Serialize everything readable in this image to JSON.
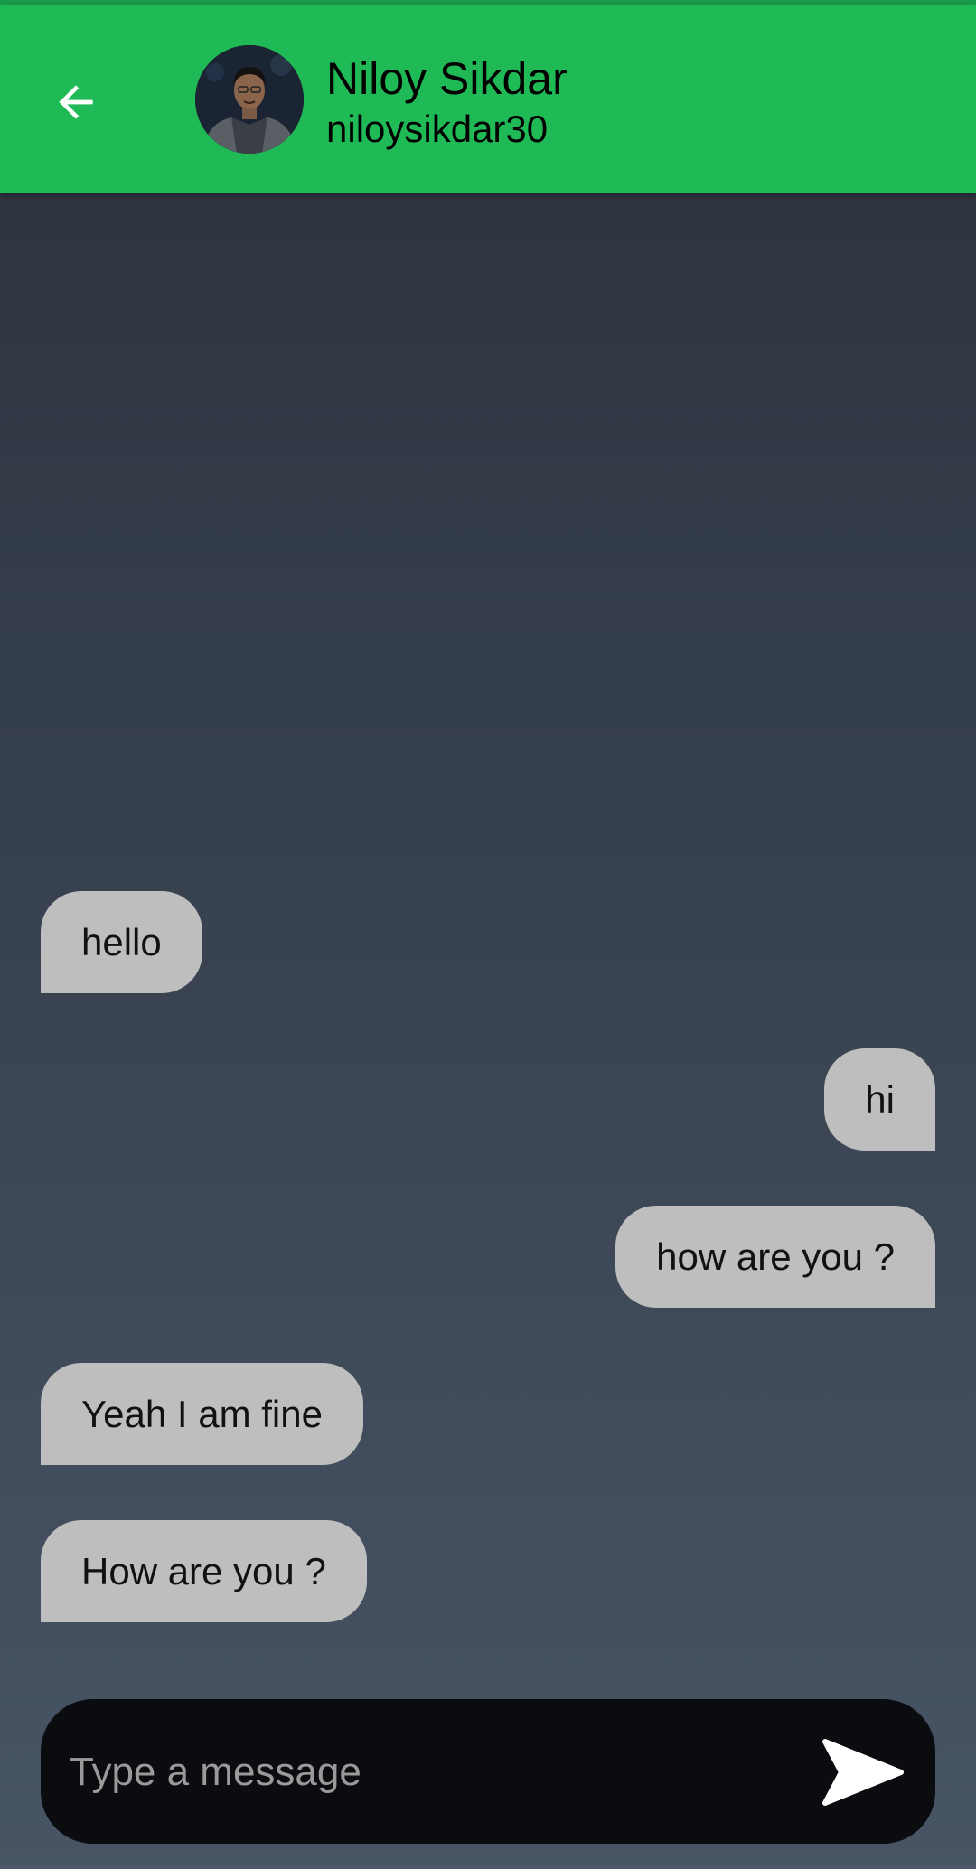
{
  "header": {
    "name": "Niloy Sikdar",
    "username": "niloysikdar30",
    "back_icon": "arrow-left-icon",
    "avatar_icon": "profile-photo"
  },
  "messages": [
    {
      "text": "hello",
      "direction": "received"
    },
    {
      "text": "hi",
      "direction": "sent"
    },
    {
      "text": "how are you ?",
      "direction": "sent"
    },
    {
      "text": "Yeah I am fine",
      "direction": "received"
    },
    {
      "text": "How are you ?",
      "direction": "received"
    }
  ],
  "composer": {
    "placeholder": "Type a message",
    "value": "",
    "send_icon": "send-icon"
  },
  "colors": {
    "appbar": "#1fba56",
    "bubble": "#bebebe",
    "composer": "#0a0c0f",
    "background_top": "#2a313c",
    "background_bottom": "#485565"
  }
}
